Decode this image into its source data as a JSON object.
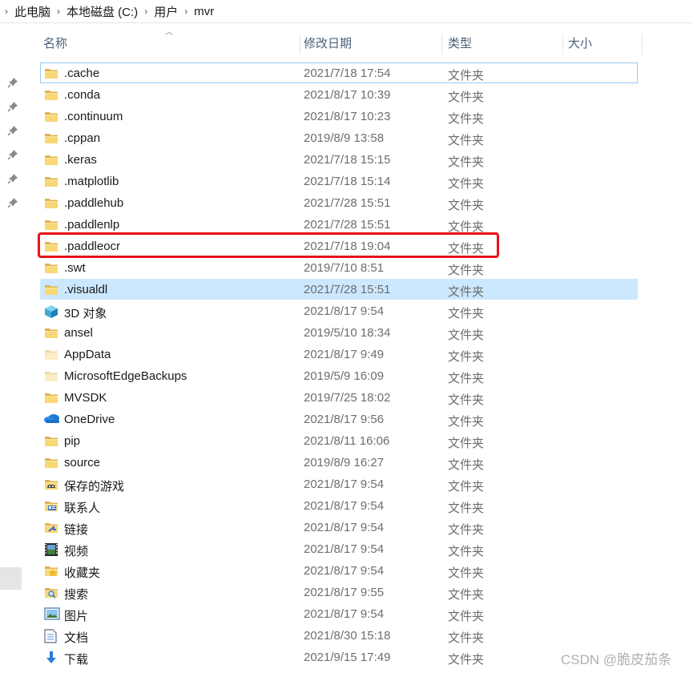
{
  "breadcrumb": [
    "此电脑",
    "本地磁盘 (C:)",
    "用户",
    "mvr"
  ],
  "columns": {
    "name": "名称",
    "date": "修改日期",
    "type": "类型",
    "size": "大小"
  },
  "files": [
    {
      "name": ".cache",
      "date": "2021/7/18 17:54",
      "type": "文件夹",
      "icon": "folder-icon"
    },
    {
      "name": ".conda",
      "date": "2021/8/17 10:39",
      "type": "文件夹",
      "icon": "folder-icon"
    },
    {
      "name": ".continuum",
      "date": "2021/8/17 10:23",
      "type": "文件夹",
      "icon": "folder-icon"
    },
    {
      "name": ".cppan",
      "date": "2019/8/9 13:58",
      "type": "文件夹",
      "icon": "folder-icon"
    },
    {
      "name": ".keras",
      "date": "2021/7/18 15:15",
      "type": "文件夹",
      "icon": "folder-icon"
    },
    {
      "name": ".matplotlib",
      "date": "2021/7/18 15:14",
      "type": "文件夹",
      "icon": "folder-icon"
    },
    {
      "name": ".paddlehub",
      "date": "2021/7/28 15:51",
      "type": "文件夹",
      "icon": "folder-icon"
    },
    {
      "name": ".paddlenlp",
      "date": "2021/7/28 15:51",
      "type": "文件夹",
      "icon": "folder-icon"
    },
    {
      "name": ".paddleocr",
      "date": "2021/7/18 19:04",
      "type": "文件夹",
      "icon": "folder-icon"
    },
    {
      "name": ".swt",
      "date": "2019/7/10 8:51",
      "type": "文件夹",
      "icon": "folder-icon"
    },
    {
      "name": ".visualdl",
      "date": "2021/7/28 15:51",
      "type": "文件夹",
      "icon": "folder-icon"
    },
    {
      "name": "3D 对象",
      "date": "2021/8/17 9:54",
      "type": "文件夹",
      "icon": "3d-objects-icon"
    },
    {
      "name": "ansel",
      "date": "2019/5/10 18:34",
      "type": "文件夹",
      "icon": "folder-icon"
    },
    {
      "name": "AppData",
      "date": "2021/8/17 9:49",
      "type": "文件夹",
      "icon": "hidden-folder-icon"
    },
    {
      "name": "MicrosoftEdgeBackups",
      "date": "2019/5/9 16:09",
      "type": "文件夹",
      "icon": "hidden-folder-icon"
    },
    {
      "name": "MVSDK",
      "date": "2019/7/25 18:02",
      "type": "文件夹",
      "icon": "folder-icon"
    },
    {
      "name": "OneDrive",
      "date": "2021/8/17 9:56",
      "type": "文件夹",
      "icon": "onedrive-icon"
    },
    {
      "name": "pip",
      "date": "2021/8/11 16:06",
      "type": "文件夹",
      "icon": "folder-icon"
    },
    {
      "name": "source",
      "date": "2019/8/9 16:27",
      "type": "文件夹",
      "icon": "folder-icon"
    },
    {
      "name": "保存的游戏",
      "date": "2021/8/17 9:54",
      "type": "文件夹",
      "icon": "saved-games-icon"
    },
    {
      "name": "联系人",
      "date": "2021/8/17 9:54",
      "type": "文件夹",
      "icon": "contacts-icon"
    },
    {
      "name": "链接",
      "date": "2021/8/17 9:54",
      "type": "文件夹",
      "icon": "links-icon"
    },
    {
      "name": "视频",
      "date": "2021/8/17 9:54",
      "type": "文件夹",
      "icon": "videos-icon"
    },
    {
      "name": "收藏夹",
      "date": "2021/8/17 9:54",
      "type": "文件夹",
      "icon": "favorites-icon"
    },
    {
      "name": "搜索",
      "date": "2021/8/17 9:55",
      "type": "文件夹",
      "icon": "searches-icon"
    },
    {
      "name": "图片",
      "date": "2021/8/17 9:54",
      "type": "文件夹",
      "icon": "pictures-icon"
    },
    {
      "name": "文档",
      "date": "2021/8/30 15:18",
      "type": "文件夹",
      "icon": "documents-icon"
    },
    {
      "name": "下载",
      "date": "2021/9/15 17:49",
      "type": "文件夹",
      "icon": "downloads-icon"
    }
  ],
  "focused_row": ".cache",
  "selected_row": ".visualdl",
  "highlighted_row": ".paddleocr",
  "colors": {
    "highlight": "#e8121a",
    "selection": "#cce8ff",
    "folder": "#f8d775"
  },
  "watermark": "CSDN @脆皮茄条"
}
